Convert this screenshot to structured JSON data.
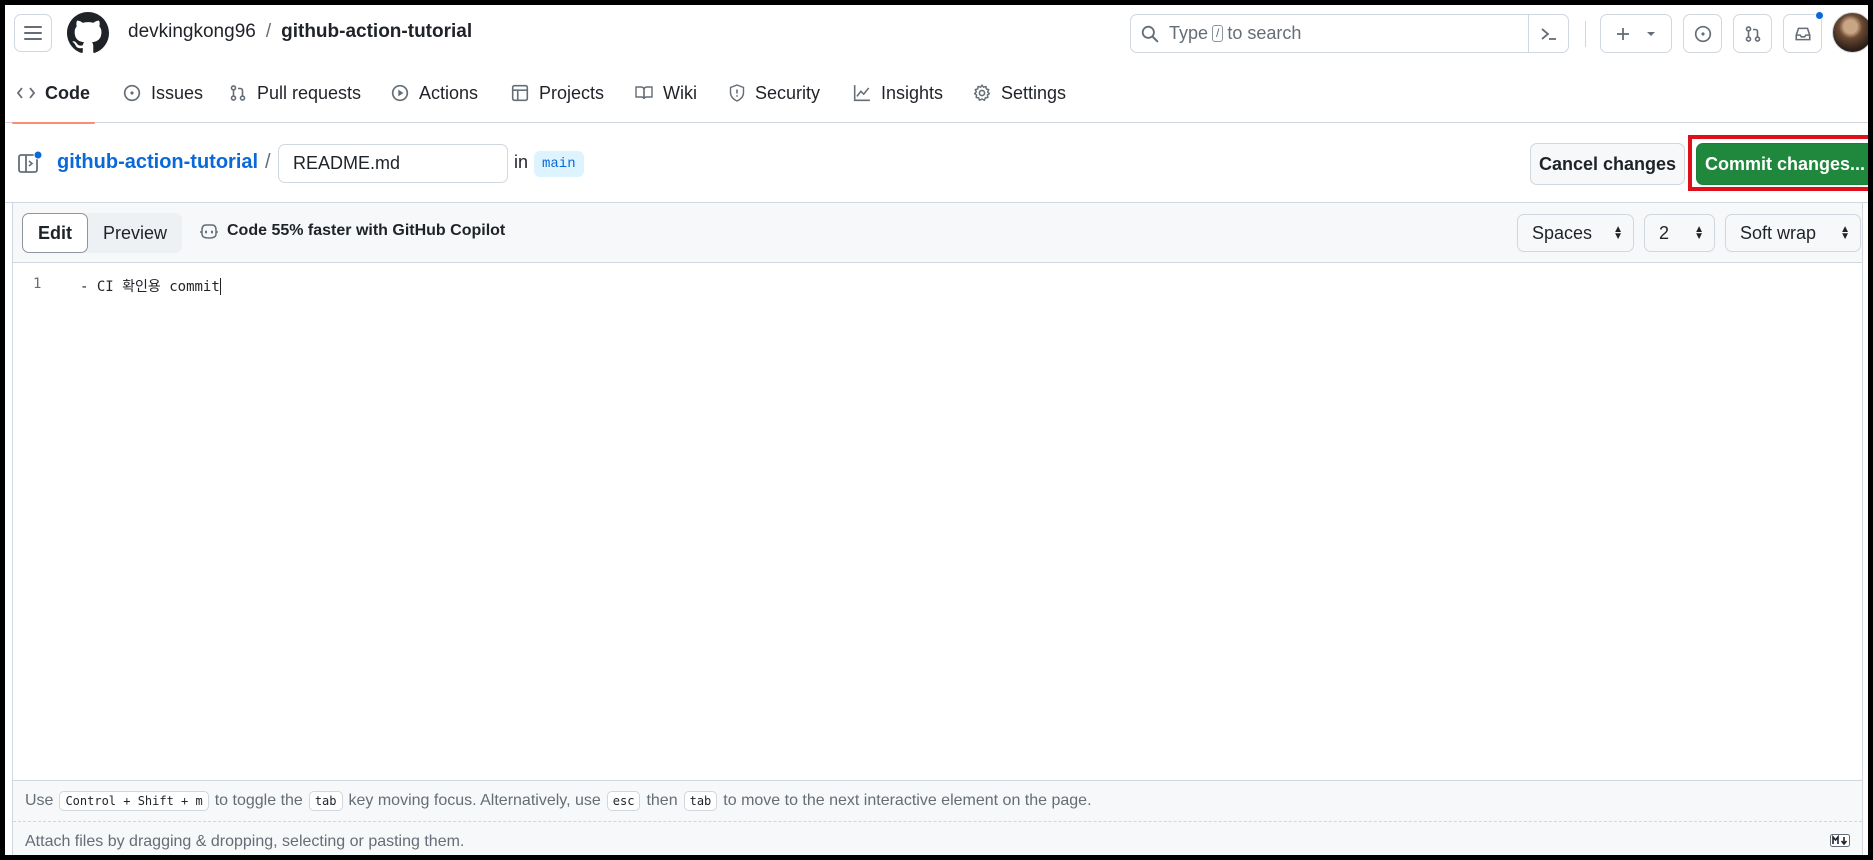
{
  "header": {
    "owner": "devkingkong96",
    "separator": "/",
    "repo": "github-action-tutorial",
    "search_prefix": "Type",
    "search_key": "/",
    "search_suffix": "to search"
  },
  "nav": {
    "tabs": [
      {
        "label": "Code",
        "icon": "code-icon"
      },
      {
        "label": "Issues",
        "icon": "issue-icon"
      },
      {
        "label": "Pull requests",
        "icon": "pull-request-icon"
      },
      {
        "label": "Actions",
        "icon": "play-icon"
      },
      {
        "label": "Projects",
        "icon": "table-icon"
      },
      {
        "label": "Wiki",
        "icon": "book-icon"
      },
      {
        "label": "Security",
        "icon": "shield-icon"
      },
      {
        "label": "Insights",
        "icon": "graph-icon"
      },
      {
        "label": "Settings",
        "icon": "gear-icon"
      }
    ]
  },
  "path": {
    "repo_link": "github-action-tutorial",
    "separator": "/",
    "file_name": "README.md",
    "in_label": "in",
    "branch": "main",
    "cancel_label": "Cancel changes",
    "commit_label": "Commit changes..."
  },
  "editor": {
    "edit_tab": "Edit",
    "preview_tab": "Preview",
    "copilot_text": "Code 55% faster with GitHub Copilot",
    "indent_mode": "Spaces",
    "indent_size": "2",
    "wrap_mode": "Soft wrap",
    "lines": [
      {
        "number": "1",
        "text": "- CI 확인용 commit"
      }
    ]
  },
  "footer": {
    "hint_use": "Use",
    "hint_keys": "Control + Shift + m",
    "hint_toggle": "to toggle the",
    "hint_tab": "tab",
    "hint_moving": "key moving focus. Alternatively, use",
    "hint_esc": "esc",
    "hint_then": "then",
    "hint_tab2": "tab",
    "hint_end": "to move to the next interactive element on the page.",
    "attach_text": "Attach files by dragging & dropping, selecting or pasting them."
  },
  "colors": {
    "accent": "#0969da",
    "commit_green": "#1f883d",
    "highlight_red": "#e0101a",
    "tab_underline": "#fd8c73"
  }
}
